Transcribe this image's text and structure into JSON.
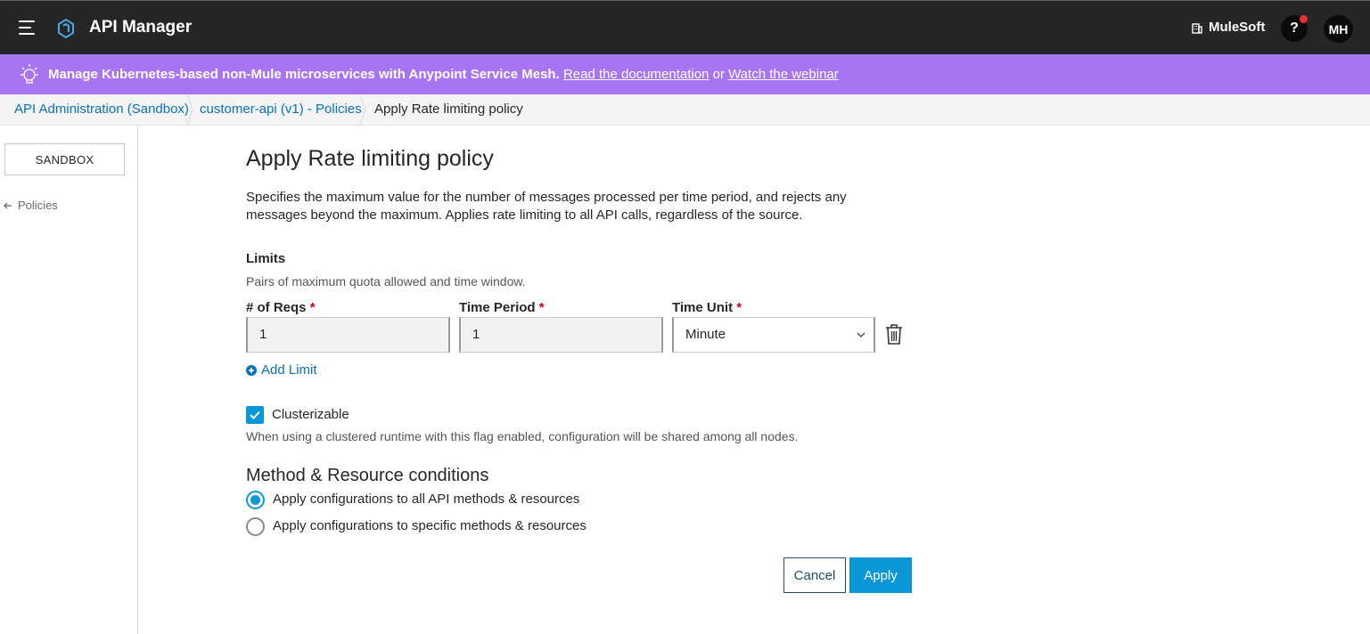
{
  "topbar": {
    "app_title": "API Manager",
    "org_name": "MuleSoft",
    "help_label": "?",
    "avatar_initials": "MH"
  },
  "banner": {
    "message": "Manage Kubernetes-based non-Mule microservices with Anypoint Service Mesh.",
    "link_docs": "Read the documentation",
    "connector": "or",
    "link_webinar": "Watch the webinar"
  },
  "breadcrumbs": {
    "item1": "API Administration (Sandbox)",
    "item2": "customer-api (v1) - Policies",
    "item3": "Apply Rate limiting policy"
  },
  "sidebar": {
    "environment": "SANDBOX",
    "back_label": "Policies"
  },
  "main": {
    "title": "Apply Rate limiting policy",
    "description": "Specifies the maximum value for the number of messages processed per time period, and rejects any messages beyond the maximum. Applies rate limiting to all API calls, regardless of the source.",
    "limits_heading": "Limits",
    "limits_sub": "Pairs of maximum quota allowed and time window.",
    "fields": {
      "reqs_label": "# of Reqs",
      "reqs_value": "1",
      "period_label": "Time Period",
      "period_value": "1",
      "unit_label": "Time Unit",
      "unit_value": "Minute",
      "required_mark": "*"
    },
    "add_limit": "Add Limit",
    "clusterizable_label": "Clusterizable",
    "clusterizable_checked": true,
    "clusterizable_hint": "When using a clustered runtime with this flag enabled, configuration will be shared among all nodes.",
    "conditions_heading": "Method & Resource conditions",
    "radio_all": "Apply configurations to all API methods & resources",
    "radio_specific": "Apply configurations to specific methods & resources",
    "cancel": "Cancel",
    "apply": "Apply"
  },
  "colors": {
    "topbar": "#262626",
    "banner": "#a775f2",
    "accent": "#0a97d8",
    "link": "#0a73b5"
  }
}
